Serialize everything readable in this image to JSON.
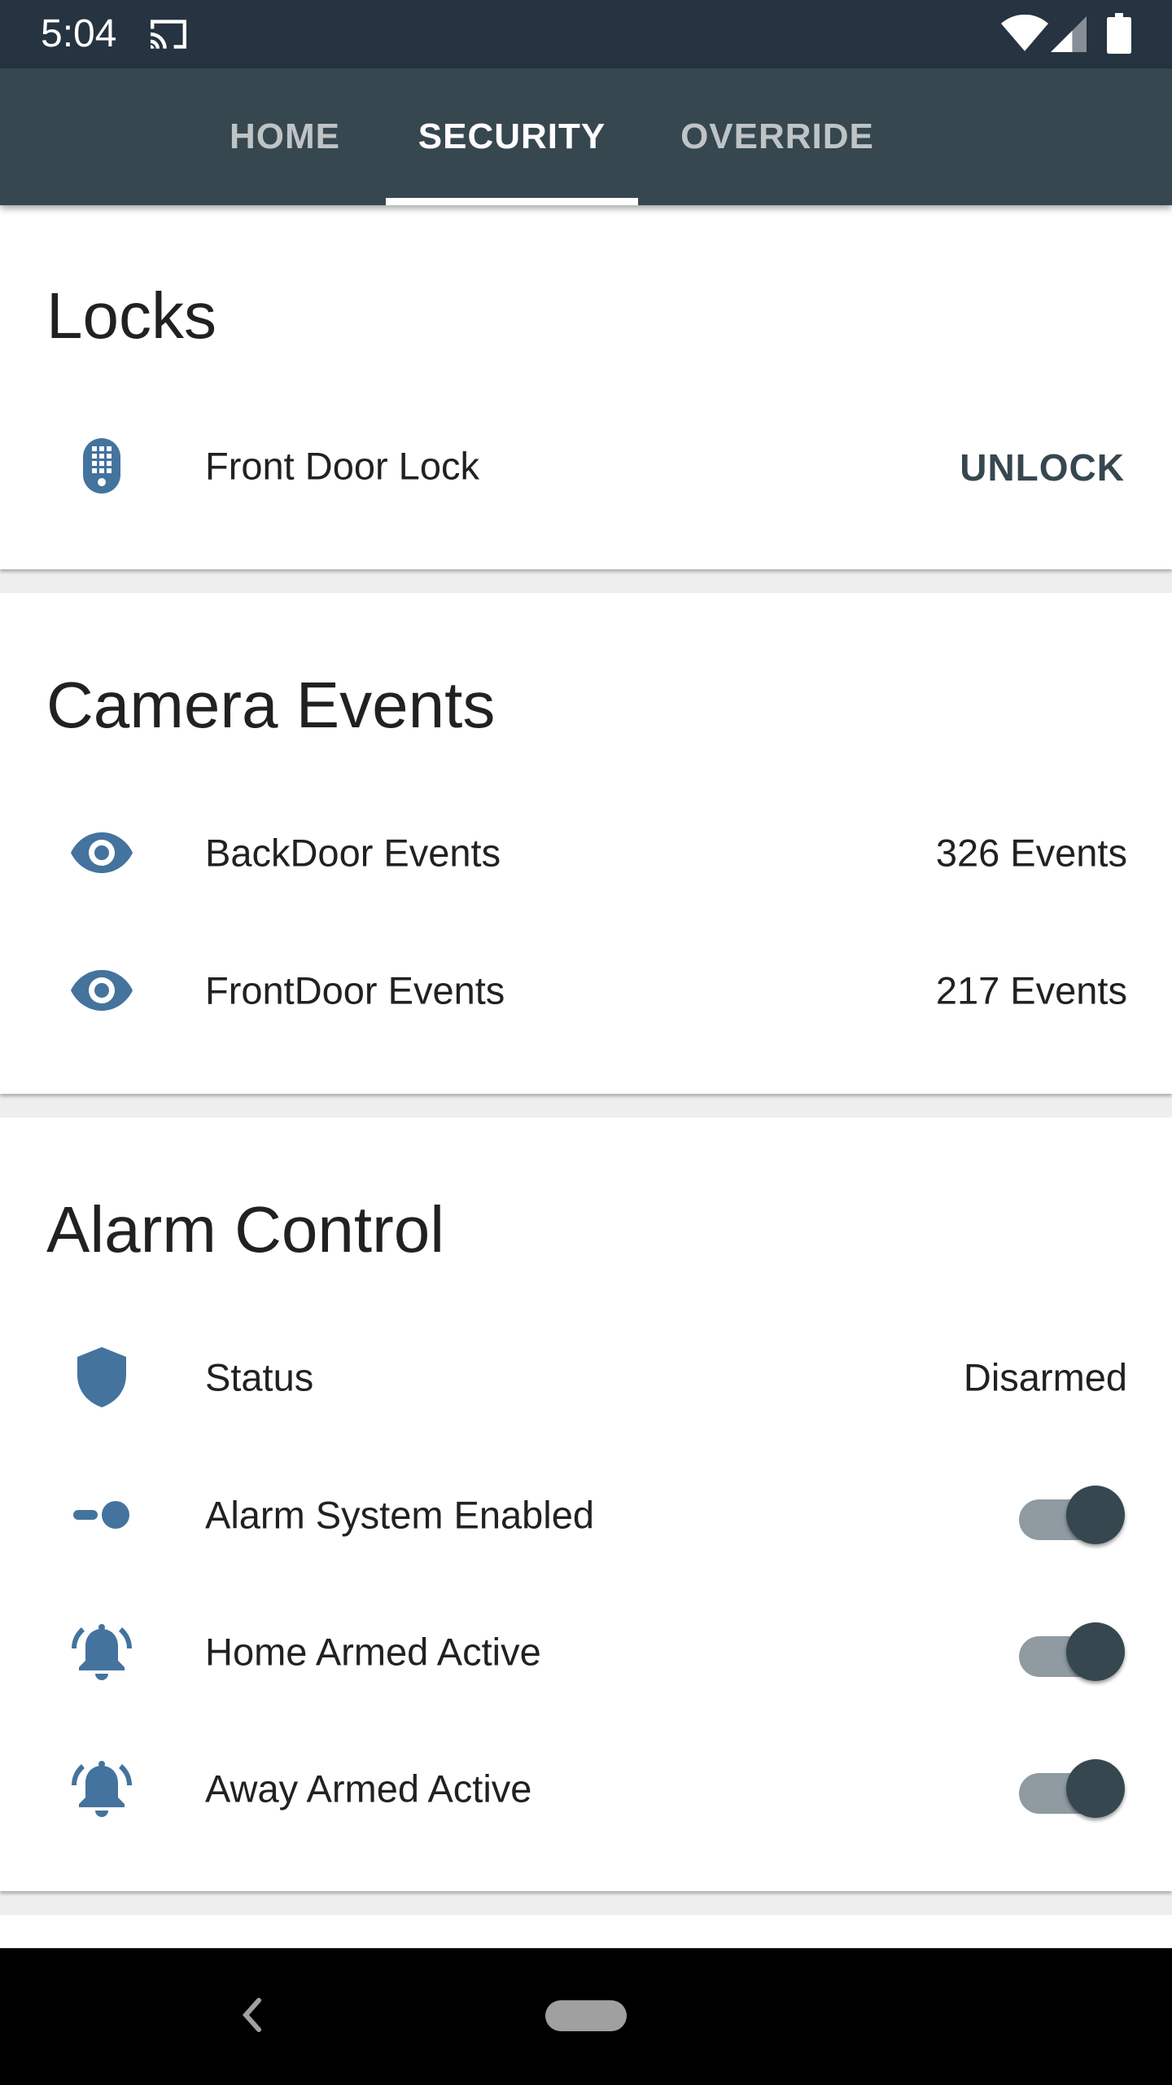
{
  "status_bar": {
    "time": "5:04"
  },
  "tabs": [
    {
      "label": "HOME",
      "active": false
    },
    {
      "label": "SECURITY",
      "active": true
    },
    {
      "label": "OVERRIDE",
      "active": false
    }
  ],
  "locks": {
    "title": "Locks",
    "items": [
      {
        "icon": "keypad-lock-icon",
        "label": "Front Door Lock",
        "action": "UNLOCK"
      }
    ]
  },
  "camera_events": {
    "title": "Camera Events",
    "items": [
      {
        "icon": "eye-icon",
        "label": "BackDoor Events",
        "value": "326 Events"
      },
      {
        "icon": "eye-icon",
        "label": "FrontDoor Events",
        "value": "217 Events"
      }
    ]
  },
  "alarm_control": {
    "title": "Alarm Control",
    "items": [
      {
        "icon": "shield-icon",
        "label": "Status",
        "value": "Disarmed"
      },
      {
        "icon": "toggle-icon",
        "label": "Alarm System Enabled",
        "on": true
      },
      {
        "icon": "bell-ringing-icon",
        "label": "Home Armed Active",
        "on": true
      },
      {
        "icon": "bell-ringing-icon",
        "label": "Away Armed Active",
        "on": true
      }
    ]
  },
  "colors": {
    "status_bar": "#263340",
    "tab_bar": "#37474f",
    "icon_blue": "#44739e",
    "toggle_thumb": "#37474f",
    "toggle_track": "#8f9aa1"
  }
}
